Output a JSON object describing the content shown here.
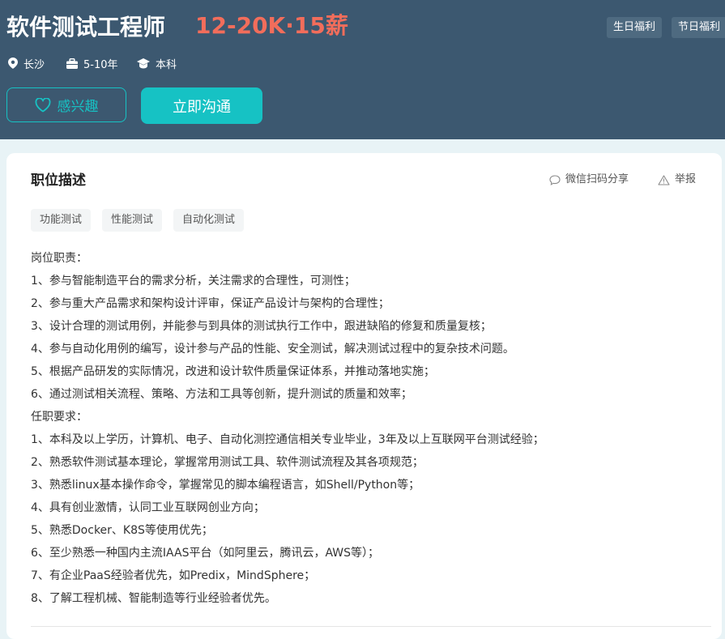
{
  "job": {
    "title": "软件测试工程师",
    "salary": "12-20K·15薪",
    "benefits": [
      "生日福利",
      "节日福利"
    ],
    "city": "长沙",
    "experience": "5-10年",
    "education": "本科"
  },
  "actions": {
    "interest_label": "感兴趣",
    "chat_label": "立即沟通"
  },
  "description": {
    "title": "职位描述",
    "share_label": "微信扫码分享",
    "report_label": "举报",
    "tags": [
      "功能测试",
      "性能测试",
      "自动化测试"
    ],
    "lines": [
      "岗位职责：",
      "1、参与智能制造平台的需求分析，关注需求的合理性，可测性；",
      "2、参与重大产品需求和架构设计评审，保证产品设计与架构的合理性；",
      "3、设计合理的测试用例，并能参与到具体的测试执行工作中，跟进缺陷的修复和质量复核；",
      "4、参与自动化用例的编写，设计参与产品的性能、安全测试，解决测试过程中的复杂技术问题。",
      "5、根据产品研发的实际情况，改进和设计软件质量保证体系，并推动落地实施；",
      "6、通过测试相关流程、策略、方法和工具等创新，提升测试的质量和效率；",
      "任职要求：",
      "1、本科及以上学历，计算机、电子、自动化测控通信相关专业毕业，3年及以上互联网平台测试经验；",
      "2、熟悉软件测试基本理论，掌握常用测试工具、软件测试流程及其各项规范；",
      "3、熟悉linux基本操作命令，掌握常见的脚本编程语言，如Shell/Python等；",
      "4、具有创业激情，认同工业互联网创业方向；",
      "5、熟悉Docker、K8S等使用优先；",
      "6、至少熟悉一种国内主流IAAS平台（如阿里云，腾讯云，AWS等）；",
      "7、有企业PaaS经验者优先，如Predix，MindSphere；",
      "8、了解工程机械、智能制造等行业经验者优先。"
    ]
  },
  "icons": {
    "location": "location-pin-icon",
    "briefcase": "briefcase-icon",
    "education": "graduation-cap-icon",
    "heart": "heart-outline-icon",
    "share": "chat-bubble-icon",
    "report": "warning-triangle-icon"
  },
  "colors": {
    "header_bg": "#3c5870",
    "salary": "#f26d5b",
    "accent": "#16c2c4",
    "page_bg": "#e8f3f6"
  }
}
